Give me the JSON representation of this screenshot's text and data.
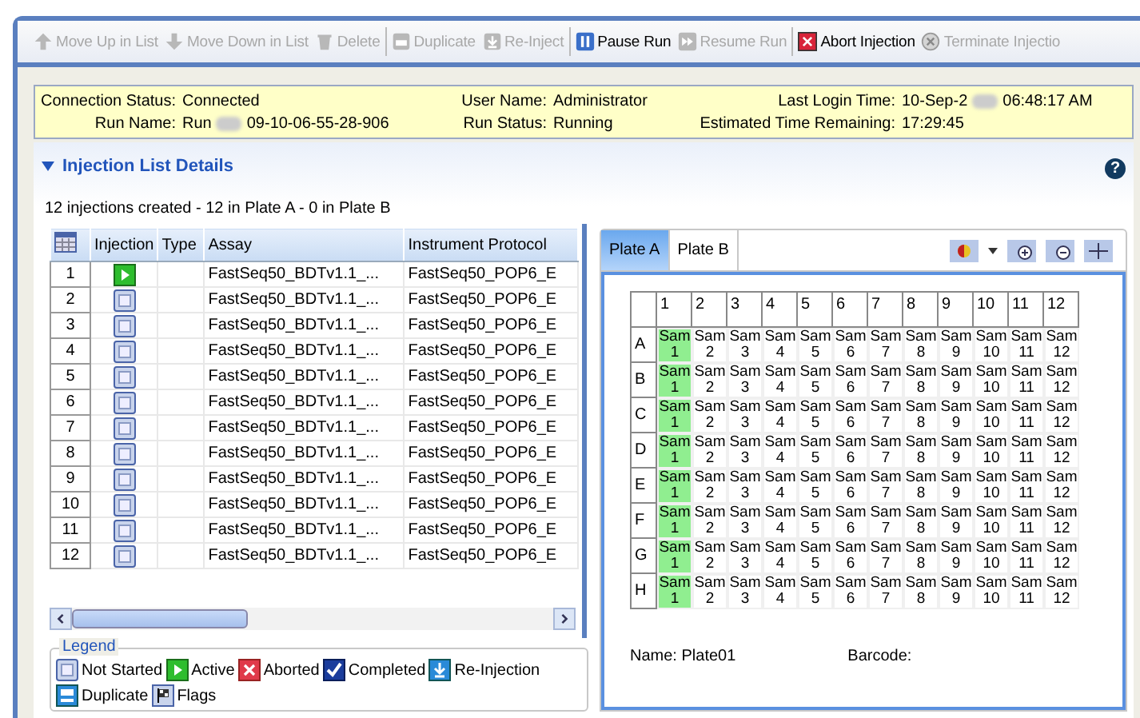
{
  "toolbar": [
    [
      {
        "label": "Move Up in List",
        "kind": "up",
        "disabled": true
      },
      {
        "label": "Move Down in List",
        "kind": "down",
        "disabled": true
      },
      {
        "label": "Delete",
        "kind": "delete",
        "disabled": true
      }
    ],
    [
      {
        "label": "Duplicate",
        "kind": "duplicate",
        "disabled": true
      },
      {
        "label": "Re-Inject",
        "kind": "reinject",
        "disabled": true
      }
    ],
    [
      {
        "label": "Pause Run",
        "kind": "pause",
        "disabled": false
      },
      {
        "label": "Resume Run",
        "kind": "resume",
        "disabled": true
      }
    ],
    [
      {
        "label": "Abort Injection",
        "kind": "abort",
        "disabled": false
      },
      {
        "label": "Terminate Injectio",
        "kind": "terminate",
        "disabled": true
      }
    ]
  ],
  "status": {
    "connection_status": {
      "label": "Connection Status:",
      "value": "Connected"
    },
    "run_name": {
      "label": "Run Name:",
      "value_start": "Run",
      "value_end": "09-10-06-55-28-906"
    },
    "user_name": {
      "label": "User Name:",
      "value": "Administrator"
    },
    "run_status": {
      "label": "Run Status:",
      "value": "Running"
    },
    "last_login_time": {
      "label": "Last Login Time:",
      "value_start": "10-Sep-2",
      "value_end": "06:48:17 AM"
    },
    "estimated_time_remaining": {
      "label": "Estimated Time Remaining:",
      "value": "17:29:45"
    }
  },
  "section": {
    "title": "Injection List Details",
    "expanded": true,
    "help": "?"
  },
  "summary": "12 injections created  - 12 in Plate A - 0 in Plate B",
  "table": {
    "columns": [
      "Injection",
      "Type",
      "Assay",
      "Instrument Protocol"
    ],
    "rows": [
      {
        "number": "1",
        "kind": "active",
        "assay": "FastSeq50_BDTv1.1_...",
        "protocol": "FastSeq50_POP6_E"
      },
      {
        "number": "2",
        "kind": "not_started",
        "assay": "FastSeq50_BDTv1.1_...",
        "protocol": "FastSeq50_POP6_E"
      },
      {
        "number": "3",
        "kind": "not_started",
        "assay": "FastSeq50_BDTv1.1_...",
        "protocol": "FastSeq50_POP6_E"
      },
      {
        "number": "4",
        "kind": "not_started",
        "assay": "FastSeq50_BDTv1.1_...",
        "protocol": "FastSeq50_POP6_E"
      },
      {
        "number": "5",
        "kind": "not_started",
        "assay": "FastSeq50_BDTv1.1_...",
        "protocol": "FastSeq50_POP6_E"
      },
      {
        "number": "6",
        "kind": "not_started",
        "assay": "FastSeq50_BDTv1.1_...",
        "protocol": "FastSeq50_POP6_E"
      },
      {
        "number": "7",
        "kind": "not_started",
        "assay": "FastSeq50_BDTv1.1_...",
        "protocol": "FastSeq50_POP6_E"
      },
      {
        "number": "8",
        "kind": "not_started",
        "assay": "FastSeq50_BDTv1.1_...",
        "protocol": "FastSeq50_POP6_E"
      },
      {
        "number": "9",
        "kind": "not_started",
        "assay": "FastSeq50_BDTv1.1_...",
        "protocol": "FastSeq50_POP6_E"
      },
      {
        "number": "10",
        "kind": "not_started",
        "assay": "FastSeq50_BDTv1.1_...",
        "protocol": "FastSeq50_POP6_E"
      },
      {
        "number": "11",
        "kind": "not_started",
        "assay": "FastSeq50_BDTv1.1_...",
        "protocol": "FastSeq50_POP6_E"
      },
      {
        "number": "12",
        "kind": "not_started",
        "assay": "FastSeq50_BDTv1.1_...",
        "protocol": "FastSeq50_POP6_E"
      }
    ]
  },
  "legend": {
    "title": "Legend",
    "items": [
      {
        "kind": "not_started",
        "label": "Not Started"
      },
      {
        "kind": "active",
        "label": "Active"
      },
      {
        "kind": "aborted",
        "label": "Aborted"
      },
      {
        "kind": "completed",
        "label": "Completed"
      },
      {
        "kind": "reinjection",
        "label": "Re-Injection"
      },
      {
        "kind": "duplicate",
        "label": "Duplicate"
      },
      {
        "kind": "flags",
        "label": "Flags"
      }
    ]
  },
  "plate_tabs": [
    {
      "label": "Plate A",
      "selected": true
    },
    {
      "label": "Plate B",
      "selected": false
    }
  ],
  "plate": {
    "columns": [
      "1",
      "2",
      "3",
      "4",
      "5",
      "6",
      "7",
      "8",
      "9",
      "10",
      "11",
      "12"
    ],
    "rows": [
      {
        "label": "A",
        "cells": [
          {
            "text": "Sam",
            "number": "1",
            "active": true
          },
          {
            "text": "Sam",
            "number": "2",
            "active": false
          },
          {
            "text": "Sam",
            "number": "3",
            "active": false
          },
          {
            "text": "Sam",
            "number": "4",
            "active": false
          },
          {
            "text": "Sam",
            "number": "5",
            "active": false
          },
          {
            "text": "Sam",
            "number": "6",
            "active": false
          },
          {
            "text": "Sam",
            "number": "7",
            "active": false
          },
          {
            "text": "Sam",
            "number": "8",
            "active": false
          },
          {
            "text": "Sam",
            "number": "9",
            "active": false
          },
          {
            "text": "Sam",
            "number": "10",
            "active": false
          },
          {
            "text": "Sam",
            "number": "11",
            "active": false
          },
          {
            "text": "Sam",
            "number": "12",
            "active": false
          }
        ]
      },
      {
        "label": "B",
        "cells": [
          {
            "text": "Sam",
            "number": "1",
            "active": true
          },
          {
            "text": "Sam",
            "number": "2",
            "active": false
          },
          {
            "text": "Sam",
            "number": "3",
            "active": false
          },
          {
            "text": "Sam",
            "number": "4",
            "active": false
          },
          {
            "text": "Sam",
            "number": "5",
            "active": false
          },
          {
            "text": "Sam",
            "number": "6",
            "active": false
          },
          {
            "text": "Sam",
            "number": "7",
            "active": false
          },
          {
            "text": "Sam",
            "number": "8",
            "active": false
          },
          {
            "text": "Sam",
            "number": "9",
            "active": false
          },
          {
            "text": "Sam",
            "number": "10",
            "active": false
          },
          {
            "text": "Sam",
            "number": "11",
            "active": false
          },
          {
            "text": "Sam",
            "number": "12",
            "active": false
          }
        ]
      },
      {
        "label": "C",
        "cells": [
          {
            "text": "Sam",
            "number": "1",
            "active": true
          },
          {
            "text": "Sam",
            "number": "2",
            "active": false
          },
          {
            "text": "Sam",
            "number": "3",
            "active": false
          },
          {
            "text": "Sam",
            "number": "4",
            "active": false
          },
          {
            "text": "Sam",
            "number": "5",
            "active": false
          },
          {
            "text": "Sam",
            "number": "6",
            "active": false
          },
          {
            "text": "Sam",
            "number": "7",
            "active": false
          },
          {
            "text": "Sam",
            "number": "8",
            "active": false
          },
          {
            "text": "Sam",
            "number": "9",
            "active": false
          },
          {
            "text": "Sam",
            "number": "10",
            "active": false
          },
          {
            "text": "Sam",
            "number": "11",
            "active": false
          },
          {
            "text": "Sam",
            "number": "12",
            "active": false
          }
        ]
      },
      {
        "label": "D",
        "cells": [
          {
            "text": "Sam",
            "number": "1",
            "active": true
          },
          {
            "text": "Sam",
            "number": "2",
            "active": false
          },
          {
            "text": "Sam",
            "number": "3",
            "active": false
          },
          {
            "text": "Sam",
            "number": "4",
            "active": false
          },
          {
            "text": "Sam",
            "number": "5",
            "active": false
          },
          {
            "text": "Sam",
            "number": "6",
            "active": false
          },
          {
            "text": "Sam",
            "number": "7",
            "active": false
          },
          {
            "text": "Sam",
            "number": "8",
            "active": false
          },
          {
            "text": "Sam",
            "number": "9",
            "active": false
          },
          {
            "text": "Sam",
            "number": "10",
            "active": false
          },
          {
            "text": "Sam",
            "number": "11",
            "active": false
          },
          {
            "text": "Sam",
            "number": "12",
            "active": false
          }
        ]
      },
      {
        "label": "E",
        "cells": [
          {
            "text": "Sam",
            "number": "1",
            "active": true
          },
          {
            "text": "Sam",
            "number": "2",
            "active": false
          },
          {
            "text": "Sam",
            "number": "3",
            "active": false
          },
          {
            "text": "Sam",
            "number": "4",
            "active": false
          },
          {
            "text": "Sam",
            "number": "5",
            "active": false
          },
          {
            "text": "Sam",
            "number": "6",
            "active": false
          },
          {
            "text": "Sam",
            "number": "7",
            "active": false
          },
          {
            "text": "Sam",
            "number": "8",
            "active": false
          },
          {
            "text": "Sam",
            "number": "9",
            "active": false
          },
          {
            "text": "Sam",
            "number": "10",
            "active": false
          },
          {
            "text": "Sam",
            "number": "11",
            "active": false
          },
          {
            "text": "Sam",
            "number": "12",
            "active": false
          }
        ]
      },
      {
        "label": "F",
        "cells": [
          {
            "text": "Sam",
            "number": "1",
            "active": true
          },
          {
            "text": "Sam",
            "number": "2",
            "active": false
          },
          {
            "text": "Sam",
            "number": "3",
            "active": false
          },
          {
            "text": "Sam",
            "number": "4",
            "active": false
          },
          {
            "text": "Sam",
            "number": "5",
            "active": false
          },
          {
            "text": "Sam",
            "number": "6",
            "active": false
          },
          {
            "text": "Sam",
            "number": "7",
            "active": false
          },
          {
            "text": "Sam",
            "number": "8",
            "active": false
          },
          {
            "text": "Sam",
            "number": "9",
            "active": false
          },
          {
            "text": "Sam",
            "number": "10",
            "active": false
          },
          {
            "text": "Sam",
            "number": "11",
            "active": false
          },
          {
            "text": "Sam",
            "number": "12",
            "active": false
          }
        ]
      },
      {
        "label": "G",
        "cells": [
          {
            "text": "Sam",
            "number": "1",
            "active": true
          },
          {
            "text": "Sam",
            "number": "2",
            "active": false
          },
          {
            "text": "Sam",
            "number": "3",
            "active": false
          },
          {
            "text": "Sam",
            "number": "4",
            "active": false
          },
          {
            "text": "Sam",
            "number": "5",
            "active": false
          },
          {
            "text": "Sam",
            "number": "6",
            "active": false
          },
          {
            "text": "Sam",
            "number": "7",
            "active": false
          },
          {
            "text": "Sam",
            "number": "8",
            "active": false
          },
          {
            "text": "Sam",
            "number": "9",
            "active": false
          },
          {
            "text": "Sam",
            "number": "10",
            "active": false
          },
          {
            "text": "Sam",
            "number": "11",
            "active": false
          },
          {
            "text": "Sam",
            "number": "12",
            "active": false
          }
        ]
      },
      {
        "label": "H",
        "cells": [
          {
            "text": "Sam",
            "number": "1",
            "active": true
          },
          {
            "text": "Sam",
            "number": "2",
            "active": false
          },
          {
            "text": "Sam",
            "number": "3",
            "active": false
          },
          {
            "text": "Sam",
            "number": "4",
            "active": false
          },
          {
            "text": "Sam",
            "number": "5",
            "active": false
          },
          {
            "text": "Sam",
            "number": "6",
            "active": false
          },
          {
            "text": "Sam",
            "number": "7",
            "active": false
          },
          {
            "text": "Sam",
            "number": "8",
            "active": false
          },
          {
            "text": "Sam",
            "number": "9",
            "active": false
          },
          {
            "text": "Sam",
            "number": "10",
            "active": false
          },
          {
            "text": "Sam",
            "number": "11",
            "active": false
          },
          {
            "text": "Sam",
            "number": "12",
            "active": false
          }
        ]
      }
    ],
    "name": {
      "label": "Name:",
      "value": "Plate01"
    },
    "barcode": {
      "label": "Barcode:"
    }
  }
}
